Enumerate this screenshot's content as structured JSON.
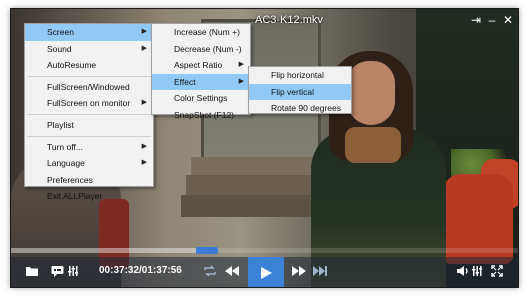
{
  "window": {
    "title": "AC3-K12.mkv",
    "controls": {
      "pin": "⇥",
      "minimize": "–",
      "close": "✕"
    }
  },
  "player": {
    "time": "00:37:32/01:37:56",
    "progress_fraction": 0.385
  },
  "main_menu": {
    "items": [
      {
        "label": "Screen",
        "submenu": true
      },
      {
        "label": "Sound",
        "submenu": true
      },
      {
        "label": "AutoResume",
        "submenu": false
      },
      {
        "label": "FullScreen/Windowed",
        "submenu": false
      },
      {
        "label": "FullScreen on monitor",
        "submenu": true
      },
      {
        "label": "Playlist",
        "submenu": false
      },
      {
        "label": "Turn off...",
        "submenu": true
      },
      {
        "label": "Language",
        "submenu": true
      },
      {
        "label": "Preferences",
        "submenu": false
      },
      {
        "label": "Exit ALLPlayer",
        "submenu": false
      }
    ]
  },
  "screen_menu": {
    "items": [
      {
        "label": "Increase (Num +)",
        "submenu": false
      },
      {
        "label": "Decrease (Num -)",
        "submenu": false
      },
      {
        "label": "Aspect Ratio",
        "submenu": true
      },
      {
        "label": "Effect",
        "submenu": true
      },
      {
        "label": "Color Settings",
        "submenu": false
      },
      {
        "label": "SnapShot (F12)",
        "submenu": false
      }
    ]
  },
  "effect_menu": {
    "items": [
      {
        "label": "Flip horizontal"
      },
      {
        "label": "Flip vertical"
      },
      {
        "label": "Rotate 90 degrees"
      }
    ]
  },
  "colors": {
    "highlight": "#91c9f7",
    "accent": "#3b82d6"
  },
  "icons": [
    "folder-icon",
    "subtitles-icon",
    "equalizer-icon",
    "repeat-icon",
    "rewind-icon",
    "play-icon",
    "fast-forward-icon",
    "skip-end-icon",
    "volume-icon",
    "audio-eq-icon",
    "fullscreen-icon"
  ]
}
